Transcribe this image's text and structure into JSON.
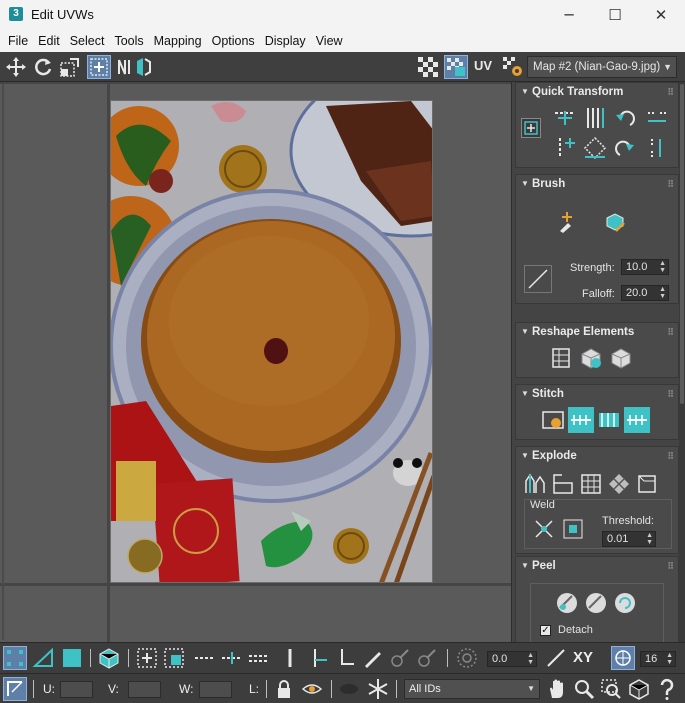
{
  "window": {
    "app_icon_text": "3",
    "title": "Edit UVWs",
    "minimize": "─",
    "maximize": "☐",
    "close": "✕"
  },
  "menu": [
    "File",
    "Edit",
    "Select",
    "Tools",
    "Mapping",
    "Options",
    "Display",
    "View"
  ],
  "toolbar": {
    "uv_label": "UV",
    "map_selected": "Map #2 (Nian-Gao-9.jpg)"
  },
  "panel": {
    "quick_transform": {
      "title": "Quick Transform"
    },
    "brush": {
      "title": "Brush",
      "strength_label": "Strength:",
      "strength_value": "10.0",
      "falloff_label": "Falloff:",
      "falloff_value": "20.0"
    },
    "reshape": {
      "title": "Reshape Elements"
    },
    "stitch": {
      "title": "Stitch"
    },
    "explode": {
      "title": "Explode",
      "weld_label": "Weld",
      "threshold_label": "Threshold:",
      "threshold_value": "0.01"
    },
    "peel": {
      "title": "Peel",
      "detach_label": "Detach",
      "detach_checked": true
    }
  },
  "bottom": {
    "angle_value": "0.0",
    "xy_label": "XY",
    "snap_value": "16",
    "u_label": "U:",
    "v_label": "V:",
    "w_label": "W:",
    "l_label": "L:",
    "ids_value": "All IDs"
  },
  "colors": {
    "accent": "#3fc2c6",
    "active_button": "#5e7fa8",
    "panel_bg": "#444444",
    "viewport_bg": "#5a5a5a"
  }
}
